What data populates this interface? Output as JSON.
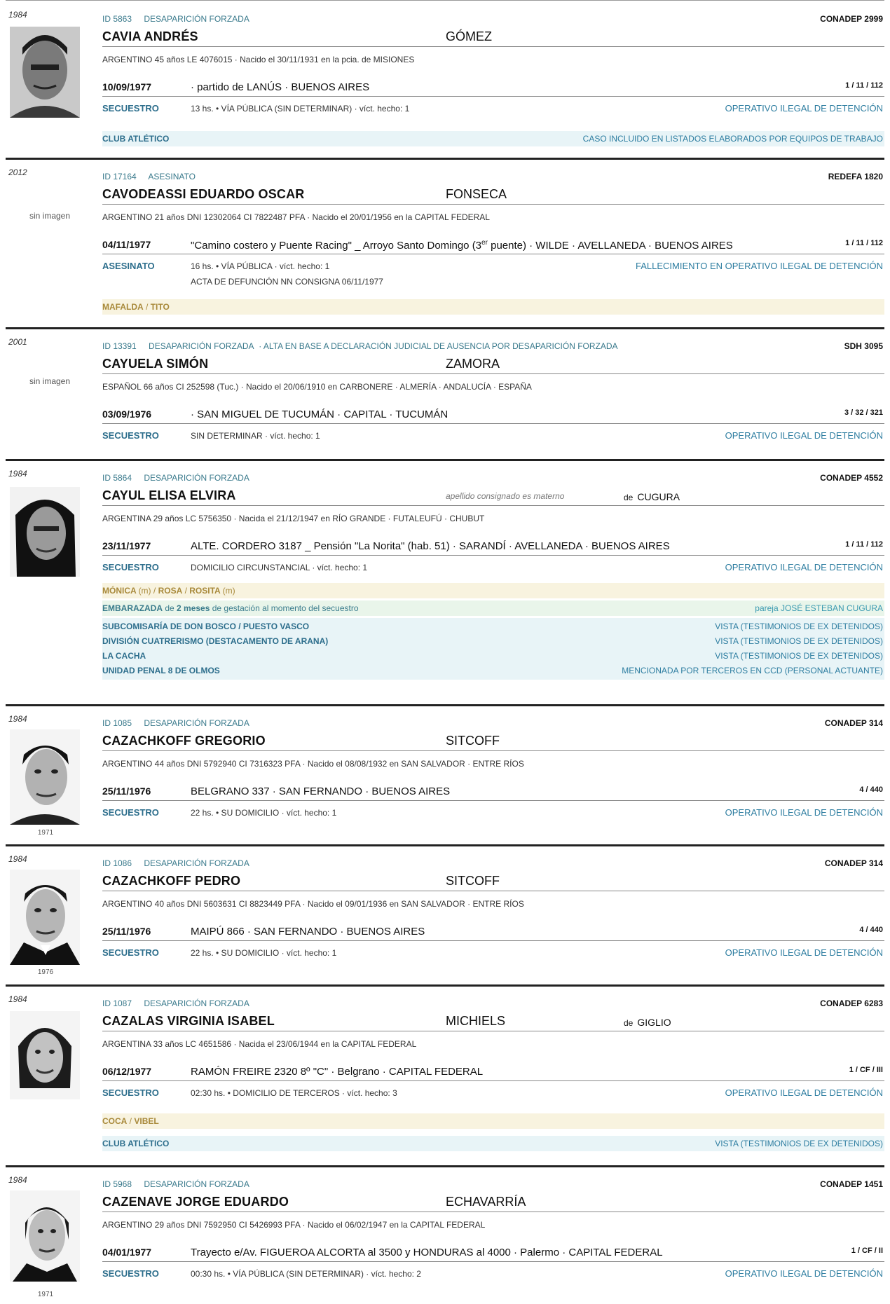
{
  "entries": [
    {
      "year": "1984",
      "id": "ID 5863",
      "type": "DESAPARICIÓN FORZADA",
      "extra": "",
      "source": "CONADEP  2999",
      "name": "CAVIA  ANDRÉS",
      "maternal": "GÓMEZ",
      "personal": "ARGENTINO   45 años   LE 4076015  ·  Nacido el 30/11/1931 en la pcia. de MISIONES",
      "date": "10/09/1977",
      "place": "·  partido de LANÚS · BUENOS AIRES",
      "ref": "1 / 11 / 112",
      "category": "SECUESTRO",
      "detail": "13 hs.  •  VÍA PÚBLICA (SIN DETERMINAR)  ·  víct. hecho: 1",
      "status": "OPERATIVO ILEGAL DE DETENCIÓN",
      "band": {
        "left": "CLUB ATLÉTICO",
        "right": "CASO INCLUIDO EN LISTADOS ELABORADOS POR EQUIPOS DE TRABAJO"
      }
    },
    {
      "year": "2012",
      "no_image": "sin imagen",
      "id": "ID 17164",
      "type": "ASESINATO",
      "source": "REDEFA  1820",
      "name": "CAVODEASSI  EDUARDO OSCAR",
      "maternal": "FONSECA",
      "personal": "ARGENTINO   21 años   DNI 12302064   CI 7822487 PFA  ·  Nacido el 20/01/1956 en la CAPITAL FEDERAL",
      "date": "04/11/1977",
      "place_a": "\"Camino costero y Puente Racing\" _ Arroyo Santo Domingo (3",
      "place_sup": "er",
      "place_b": " puente)   ·   WILDE · AVELLANEDA · BUENOS AIRES",
      "ref": "1 / 11 / 112",
      "category": "ASESINATO",
      "detail": "16 hs.  •  VÍA PÚBLICA  ·  víct. hecho: 1",
      "detail2": "ACTA DE DEFUNCIÓN NN CONSIGNA 06/11/1977",
      "status": "FALLECIMIENTO EN OPERATIVO ILEGAL DE DETENCIÓN",
      "alias": [
        "MAFALDA",
        "TITO"
      ]
    },
    {
      "year": "2001",
      "no_image": "sin imagen",
      "id": "ID 13391",
      "type": "DESAPARICIÓN FORZADA",
      "extra": "·  ALTA EN BASE A DECLARACIÓN JUDICIAL DE AUSENCIA POR DESAPARICIÓN FORZADA",
      "source": "SDH  3095",
      "name": "CAYUELA  SIMÓN",
      "maternal": "ZAMORA",
      "personal": "ESPAÑOL   66 años   CI 252598 (Tuc.)  ·  Nacido el 20/06/1910 en CARBONERE · ALMERÍA · ANDALUCÍA · ESPAÑA",
      "date": "03/09/1976",
      "place": "·  SAN MIGUEL DE TUCUMÁN · CAPITAL · TUCUMÁN",
      "ref": "3 / 32 / 321",
      "category": "SECUESTRO",
      "detail": "SIN DETERMINAR  ·  víct. hecho: 1",
      "status": "OPERATIVO ILEGAL DE DETENCIÓN"
    },
    {
      "year": "1984",
      "id": "ID 5864",
      "type": "DESAPARICIÓN FORZADA",
      "source": "CONADEP  4552",
      "name": "CAYUL  ELISA ELVIRA",
      "note": "apellido consignado es materno",
      "de_small": "de",
      "de_name": "CUGURA",
      "personal": "ARGENTINA   29 años   LC 5756350  ·  Nacida el 21/12/1947 en RÍO GRANDE · FUTALEUFÚ · CHUBUT",
      "date": "23/11/1977",
      "place": "ALTE. CORDERO 3187 _ Pensión \"La Norita\" (hab. 51)   ·   SARANDÍ · AVELLANEDA · BUENOS AIRES",
      "ref": "1 / 11 / 112",
      "category": "SECUESTRO",
      "detail": "DOMICILIO CIRCUNSTANCIAL  ·  víct. hecho: 1",
      "status": "OPERATIVO ILEGAL DE DETENCIÓN",
      "alias": [
        {
          "name": "MÓNICA",
          "mark": "(m)"
        },
        {
          "name": "ROSA",
          "mark": ""
        },
        {
          "name": "ROSITA",
          "mark": "(m)"
        }
      ],
      "pregnancy": {
        "a": "EMBARAZADA",
        "b": " de ",
        "c": "2 meses",
        "d": " de gestación al momento del secuestro",
        "partner": "pareja JOSÉ ESTEBAN CUGURA"
      },
      "ccd": [
        {
          "left": "SUBCOMISARÍA DE DON BOSCO / PUESTO VASCO",
          "right": "VISTA (TESTIMONIOS DE EX DETENIDOS)"
        },
        {
          "left": "DIVISIÓN CUATRERISMO (DESTACAMENTO DE ARANA)",
          "right": "VISTA (TESTIMONIOS DE EX DETENIDOS)"
        },
        {
          "left": "LA CACHA",
          "right": "VISTA (TESTIMONIOS DE EX DETENIDOS)"
        },
        {
          "left": "UNIDAD PENAL 8 DE OLMOS",
          "right": "MENCIONADA POR TERCEROS EN CCD (PERSONAL ACTUANTE)"
        }
      ]
    },
    {
      "year": "1984",
      "photo_year": "1971",
      "id": "ID 1085",
      "type": "DESAPARICIÓN FORZADA",
      "source": "CONADEP  314",
      "name": "CAZACHKOFF  GREGORIO",
      "maternal": "SITCOFF",
      "personal": "ARGENTINO   44 años   DNI 5792940   CI 7316323 PFA  ·  Nacido el 08/08/1932 en SAN SALVADOR · ENTRE RÍOS",
      "date": "25/11/1976",
      "place": "BELGRANO 337   ·   SAN FERNANDO · BUENOS AIRES",
      "ref": "4 / 440",
      "category": "SECUESTRO",
      "detail": "22 hs.  •  SU DOMICILIO  ·  víct. hecho: 1",
      "status": "OPERATIVO ILEGAL DE DETENCIÓN"
    },
    {
      "year": "1984",
      "photo_year": "1976",
      "id": "ID 1086",
      "type": "DESAPARICIÓN FORZADA",
      "source": "CONADEP  314",
      "name": "CAZACHKOFF  PEDRO",
      "maternal": "SITCOFF",
      "personal": "ARGENTINO   40 años   DNI 5603631   CI 8823449 PFA  ·  Nacido el 09/01/1936 en SAN SALVADOR · ENTRE RÍOS",
      "date": "25/11/1976",
      "place": "MAIPÚ 866   ·   SAN FERNANDO · BUENOS AIRES",
      "ref": "4 / 440",
      "category": "SECUESTRO",
      "detail": "22 hs.  •  SU DOMICILIO  ·  víct. hecho: 1",
      "status": "OPERATIVO ILEGAL DE DETENCIÓN"
    },
    {
      "year": "1984",
      "id": "ID 1087",
      "type": "DESAPARICIÓN FORZADA",
      "source": "CONADEP  6283",
      "name": "CAZALAS  VIRGINIA ISABEL",
      "maternal": "MICHIELS",
      "de_small": "de",
      "de_name": "GIGLIO",
      "personal": "ARGENTINA   33 años   LC 4651586  ·  Nacida el 23/06/1944 en la CAPITAL FEDERAL",
      "date": "06/12/1977",
      "place": "RAMÓN FREIRE 2320  8º \"C\"  ·  Belgrano  ·  CAPITAL FEDERAL",
      "ref": "1 / CF / III",
      "category": "SECUESTRO",
      "detail": "02:30 hs.  •  DOMICILIO DE TERCEROS  ·  víct. hecho: 3",
      "status": "OPERATIVO ILEGAL DE DETENCIÓN",
      "alias": [
        "COCA",
        "VIBEL"
      ],
      "band": {
        "left": "CLUB ATLÉTICO",
        "right": "VISTA (TESTIMONIOS DE EX DETENIDOS)"
      }
    },
    {
      "year": "1984",
      "photo_year": "1971",
      "id": "ID 5968",
      "type": "DESAPARICIÓN FORZADA",
      "source": "CONADEP  1451",
      "name": "CAZENAVE  JORGE EDUARDO",
      "maternal": "ECHAVARRÍA",
      "personal": "ARGENTINO   29 años   DNI 7592950   CI 5426993 PFA  ·  Nacido el 06/02/1947 en la CAPITAL FEDERAL",
      "date": "04/01/1977",
      "place": "Trayecto e/Av. FIGUEROA ALCORTA al 3500 y HONDURAS al 4000  ·  Palermo  ·  CAPITAL FEDERAL",
      "ref": "1 / CF / II",
      "category": "SECUESTRO",
      "detail": "00:30 hs.  •  VÍA PÚBLICA (SIN DETERMINAR)  ·  víct. hecho: 2",
      "status": "OPERATIVO ILEGAL DE DETENCIÓN"
    }
  ]
}
